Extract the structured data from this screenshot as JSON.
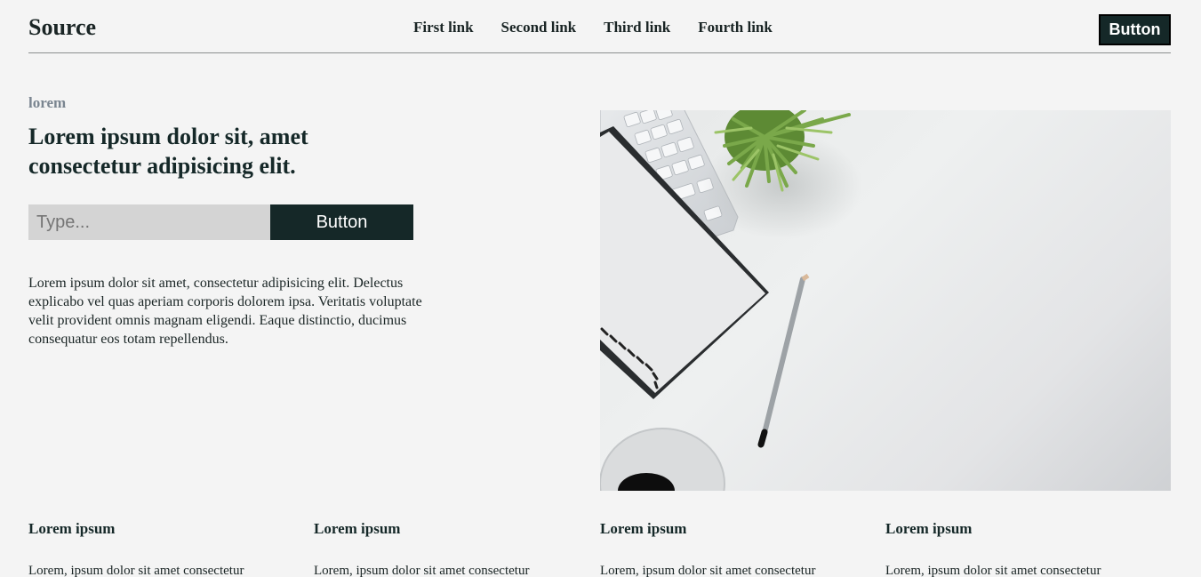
{
  "header": {
    "logo": "Source",
    "nav": [
      "First link",
      "Second link",
      "Third link",
      "Fourth link"
    ],
    "button": "Button"
  },
  "hero": {
    "eyebrow": "lorem",
    "headline": "Lorem ipsum dolor sit, amet consectetur adipisicing elit.",
    "input_placeholder": "Type...",
    "button": "Button",
    "paragraph": "Lorem ipsum dolor sit amet, consectetur adipisicing elit. Delectus explicabo vel quas aperiam corporis dolorem ipsa. Veritatis voluptate velit provident omnis magnam eligendi. Eaque distinctio, ducimus consequatur eos totam repellendus."
  },
  "features": [
    {
      "title": "Lorem ipsum",
      "text": "Lorem, ipsum dolor sit amet consectetur"
    },
    {
      "title": "Lorem ipsum",
      "text": "Lorem, ipsum dolor sit amet consectetur"
    },
    {
      "title": "Lorem ipsum",
      "text": "Lorem, ipsum dolor sit amet consectetur"
    },
    {
      "title": "Lorem ipsum",
      "text": "Lorem, ipsum dolor sit amet consectetur"
    }
  ],
  "colors": {
    "background": "#f4f4f4",
    "dark": "#152828",
    "input_bg": "#d4d4d4",
    "eyebrow": "#7a8590"
  }
}
